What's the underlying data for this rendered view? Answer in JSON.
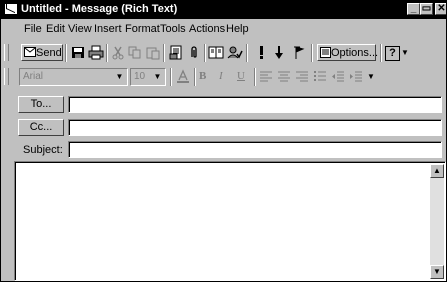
{
  "window": {
    "title": "Untitled - Message (Rich Text)",
    "controls": {
      "minimize": "_",
      "restore": "▭",
      "close": "✕"
    }
  },
  "menu": [
    "File",
    "Edit",
    "View",
    "Insert",
    "Format",
    "Tools",
    "Actions",
    "Help"
  ],
  "toolbar1": {
    "send_label": "Send",
    "options_label": "Options...",
    "help_symbol": "?"
  },
  "toolbar2": {
    "font": "Arial",
    "size": "10",
    "bold": "B",
    "italic": "I",
    "underline": "U"
  },
  "addressing": {
    "to_label": "To...",
    "cc_label": "Cc...",
    "subject_label": "Subject:",
    "to_value": "",
    "cc_value": "",
    "subject_value": ""
  },
  "body": {
    "text": ""
  },
  "icons": {
    "send": "send-icon",
    "save": "save-icon",
    "print": "print-icon",
    "cut": "cut-icon",
    "copy": "copy-icon",
    "paste": "paste-icon",
    "insert-file": "insert-file-icon",
    "attach": "paperclip-icon",
    "address-book": "address-book-icon",
    "check-names": "check-names-icon",
    "importance-high": "importance-high-icon",
    "importance-low": "importance-low-icon",
    "flag": "flag-icon"
  }
}
